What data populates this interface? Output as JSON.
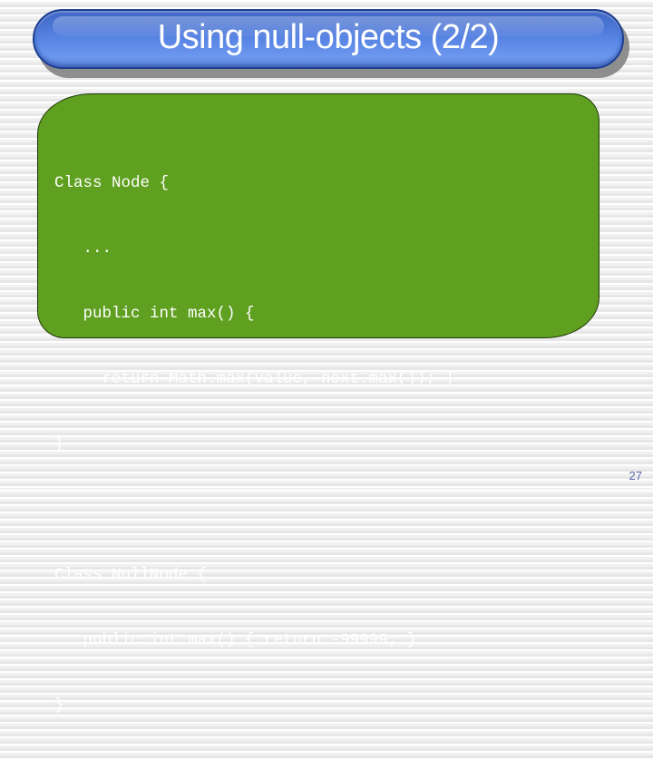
{
  "slide": {
    "title": "Using null-objects (2/2)",
    "page_number": "27",
    "colors": {
      "title_bar": "#5b88e6",
      "code_box": "#5fa020",
      "code_text": "#ffffff",
      "page_number": "#5866a8"
    },
    "code_lines": [
      "Class Node {",
      "   ...",
      "   public int max() {",
      "     return Math.max(value, next.max()); }",
      "}",
      "",
      "Class NullNode {",
      "   public int max() { return -99999; }",
      "}"
    ]
  }
}
